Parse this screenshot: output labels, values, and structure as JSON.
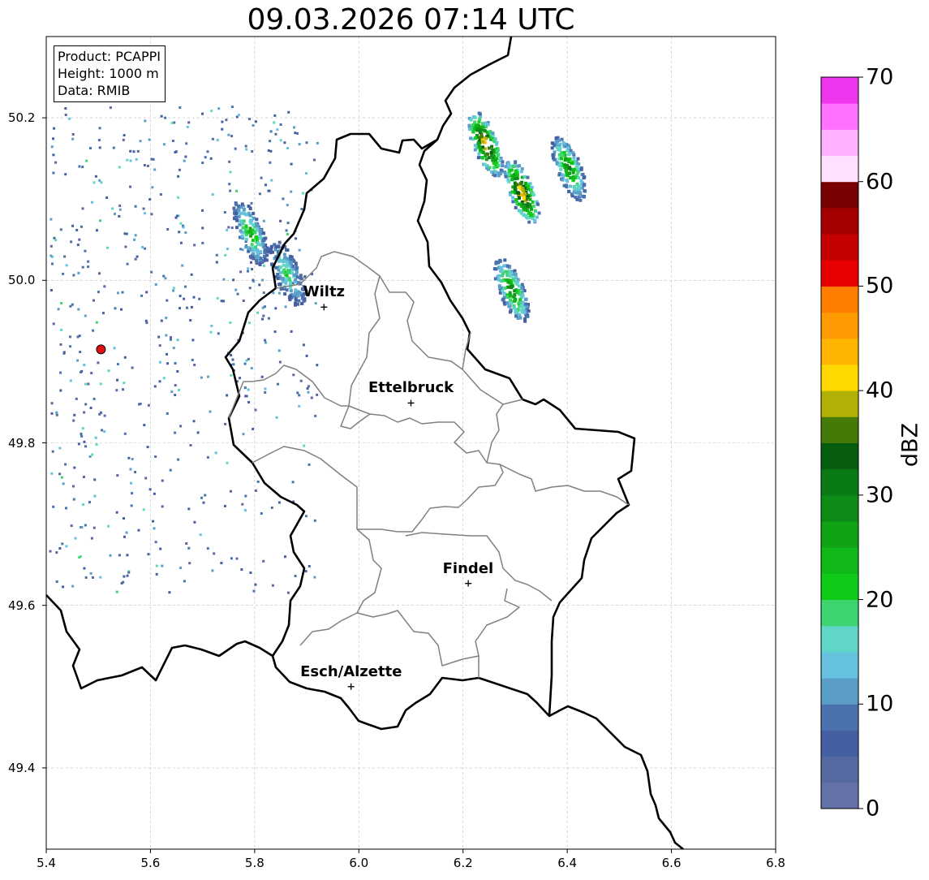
{
  "title": "09.03.2026 07:14 UTC",
  "info": {
    "product": "Product: PCAPPI",
    "height": "Height: 1000 m",
    "data": "Data: RMIB"
  },
  "map": {
    "lon_range": [
      5.4,
      6.8
    ],
    "lat_range": [
      49.3,
      50.3
    ],
    "x_ticks": [
      "5.4",
      "5.6",
      "5.8",
      "6.0",
      "6.2",
      "6.4",
      "6.6",
      "6.8"
    ],
    "y_ticks": [
      "49.4",
      "49.6",
      "49.8",
      "50.0",
      "50.2"
    ],
    "grid": true,
    "radar_site": {
      "lon": 5.505,
      "lat": 49.915,
      "color": "#e01010"
    },
    "cities": [
      {
        "name": "Wiltz",
        "lon": 5.933,
        "lat": 49.967
      },
      {
        "name": "Ettelbruck",
        "lon": 6.1,
        "lat": 49.849
      },
      {
        "name": "Findel",
        "lon": 6.21,
        "lat": 49.627
      },
      {
        "name": "Esch/Alzette",
        "lon": 5.985,
        "lat": 49.5
      }
    ],
    "echo_cells": [
      {
        "lon": 6.24,
        "lat": 50.17,
        "max_dbz": 45
      },
      {
        "lon": 6.31,
        "lat": 50.11,
        "max_dbz": 45
      },
      {
        "lon": 6.4,
        "lat": 50.14,
        "max_dbz": 30
      },
      {
        "lon": 6.29,
        "lat": 49.99,
        "max_dbz": 30
      },
      {
        "lon": 5.79,
        "lat": 50.06,
        "max_dbz": 25
      },
      {
        "lon": 5.86,
        "lat": 50.01,
        "max_dbz": 20
      }
    ]
  },
  "colorbar": {
    "label": "dBZ",
    "range": [
      0,
      70
    ],
    "ticks": [
      "0",
      "10",
      "20",
      "30",
      "40",
      "50",
      "60",
      "70"
    ],
    "colors": [
      "#6472a8",
      "#5669a0",
      "#455fa3",
      "#4a73ae",
      "#5a9ec8",
      "#66c1de",
      "#60d7c6",
      "#3ed46f",
      "#10cc18",
      "#10b818",
      "#10a316",
      "#0d8d18",
      "#0a7a14",
      "#055d0d",
      "#457a08",
      "#b0b007",
      "#ffd800",
      "#ffb500",
      "#ff9a00",
      "#ff7e00",
      "#e80000",
      "#c40000",
      "#a40000",
      "#780000",
      "#ffe0ff",
      "#ffb0ff",
      "#ff72ff",
      "#ee36ee"
    ]
  }
}
